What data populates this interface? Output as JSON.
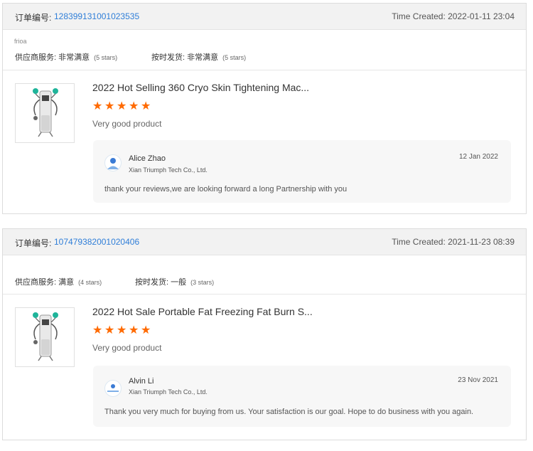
{
  "orders": [
    {
      "order_label": "订单编号:",
      "order_number": "128399131001023535",
      "time_created": "Time Created: 2022-01-11 23:04",
      "buyer": "frioa",
      "supplier_service": "供应商服务: 非常满意",
      "supplier_stars": "(5 stars)",
      "delivery": "按时发货: 非常满意",
      "delivery_stars": "(5 stars)",
      "product_title": "2022 Hot Selling 360 Cryo Skin Tightening Mac...",
      "rating": 5,
      "review": "Very good product",
      "reply": {
        "name": "Alice Zhao",
        "company": "Xian Triumph Tech Co., Ltd.",
        "date": "12 Jan 2022",
        "message": "thank your reviews,we are looking forward a long Partnership with you"
      }
    },
    {
      "order_label": "订单编号:",
      "order_number": "107479382001020406",
      "time_created": "Time Created: 2021-11-23 08:39",
      "supplier_service": "供应商服务: 满意",
      "supplier_stars": "(4 stars)",
      "delivery": "按时发货: 一般",
      "delivery_stars": "(3 stars)",
      "product_title": "2022 Hot Sale Portable Fat Freezing Fat Burn S...",
      "rating": 5,
      "review": "Very good product",
      "reply": {
        "name": "Alvin Li",
        "company": "Xian Triumph Tech Co., Ltd.",
        "date": "23 Nov 2021",
        "message": "Thank you very much for buying from us. Your satisfaction is our goal. Hope to do business with you again."
      }
    }
  ],
  "colors": {
    "accent_link": "#2f7ed8",
    "star": "#ff6a00",
    "header_bg": "#f2f2f2"
  },
  "icons": {
    "star": "star-icon",
    "product": "product-thumbnail",
    "avatar": "supplier-avatar"
  }
}
